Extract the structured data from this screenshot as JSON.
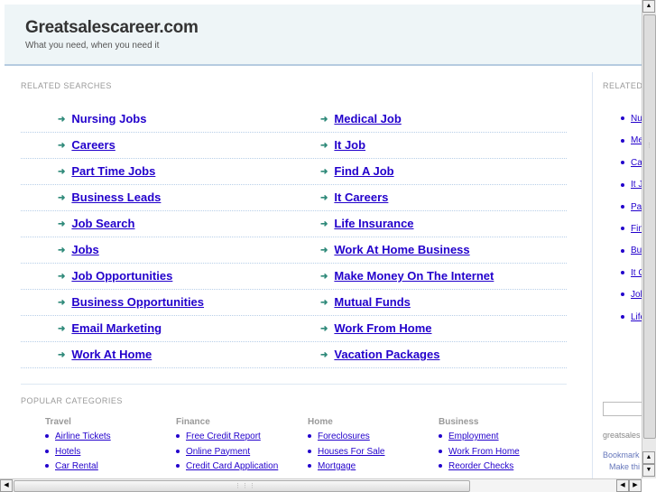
{
  "header": {
    "title": "Greatsalescareer.com",
    "tagline": "What you need, when you need it"
  },
  "related": {
    "label": "RELATED SEARCHES",
    "left": [
      "Nursing Jobs",
      "Careers",
      "Part Time Jobs",
      "Business Leads",
      "Job Search",
      "Jobs",
      "Job Opportunities",
      "Business Opportunities",
      "Email Marketing",
      "Work At Home"
    ],
    "right": [
      "Medical Job",
      "It Job",
      "Find A Job",
      "It Careers",
      "Life Insurance",
      "Work At Home Business",
      "Make Money On The Internet",
      "Mutual Funds",
      "Work From Home",
      "Vacation Packages"
    ]
  },
  "popular": {
    "label": "POPULAR CATEGORIES",
    "categories": [
      {
        "title": "Travel",
        "items": [
          "Airline Tickets",
          "Hotels",
          "Car Rental"
        ]
      },
      {
        "title": "Finance",
        "items": [
          "Free Credit Report",
          "Online Payment",
          "Credit Card Application"
        ]
      },
      {
        "title": "Home",
        "items": [
          "Foreclosures",
          "Houses For Sale",
          "Mortgage"
        ]
      },
      {
        "title": "Business",
        "items": [
          "Employment",
          "Work From Home",
          "Reorder Checks"
        ]
      }
    ]
  },
  "sidebar": {
    "label": "RELATED",
    "items": [
      "Nursing Jobs",
      "Medical Job",
      "Careers",
      "It Job",
      "Part Time Jobs",
      "Find A Job",
      "Business Leads",
      "It Careers",
      "Job Search",
      "Life Insurance"
    ],
    "domain_text": "greatsales",
    "bookmark": "Bookmark",
    "make": "Make thi"
  },
  "colors": {
    "link": "#2200cc",
    "header_bg": "#eef5f7",
    "arrow": "#2f8a7a"
  }
}
